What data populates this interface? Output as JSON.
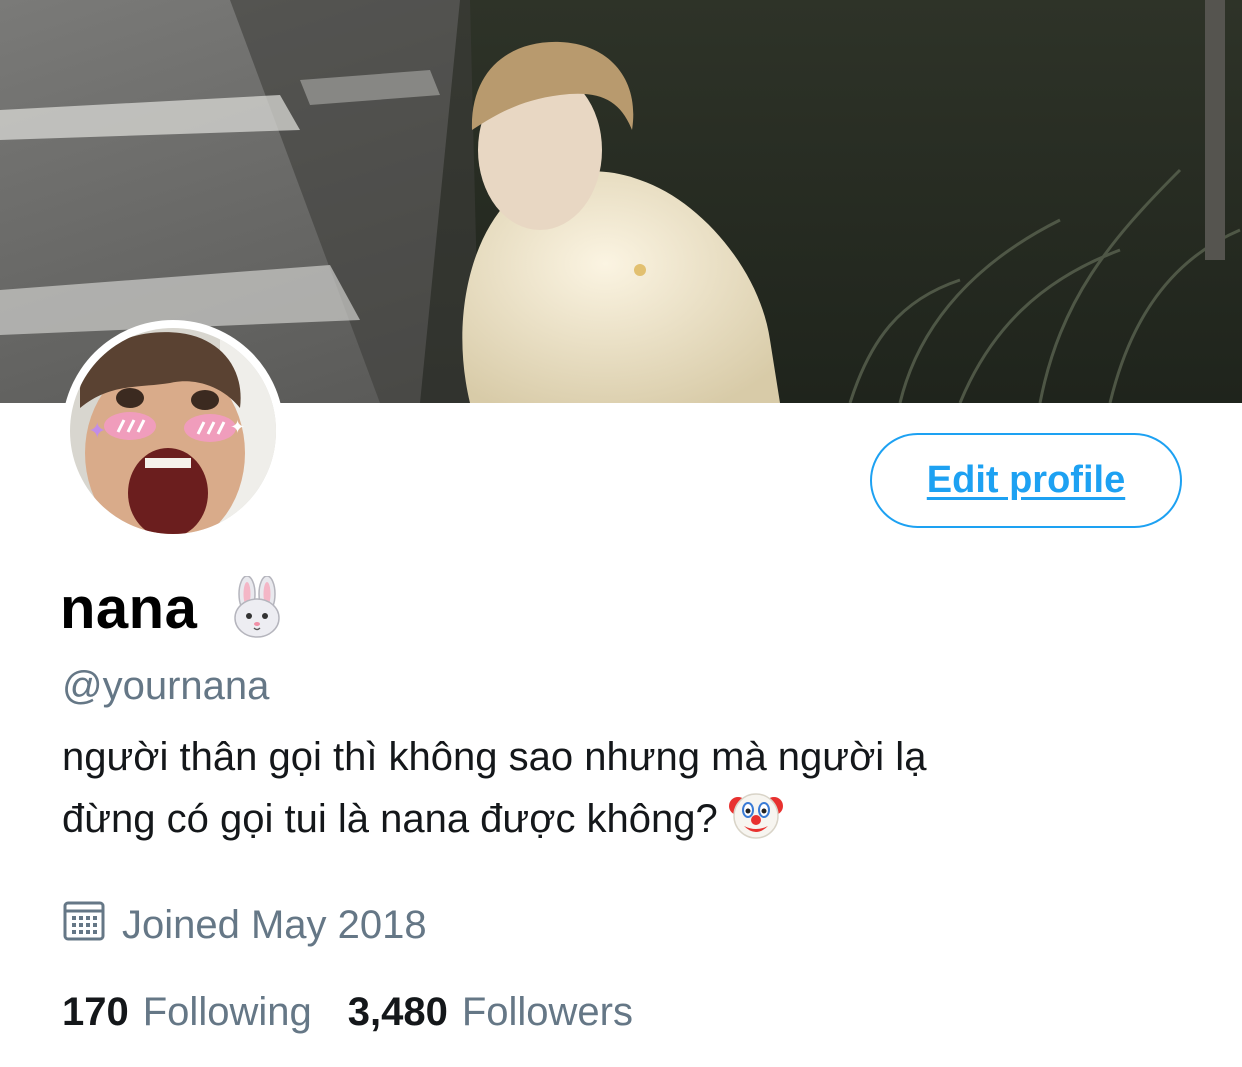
{
  "profile": {
    "display_name": "nana",
    "name_emoji": "rabbit-face-icon",
    "handle": "@yournana",
    "bio_line1": "người thân gọi thì không sao nhưng mà người lạ",
    "bio_line2": "đừng có gọi tui là nana được không?",
    "bio_emoji": "clown-face-icon",
    "joined": "Joined May 2018",
    "following_count": "170",
    "following_label": "Following",
    "followers_count": "3,480",
    "followers_label": "Followers"
  },
  "actions": {
    "edit_profile": "Edit profile"
  },
  "colors": {
    "accent": "#1da1f2",
    "secondary_text": "#657786",
    "primary_text": "#14171a"
  }
}
